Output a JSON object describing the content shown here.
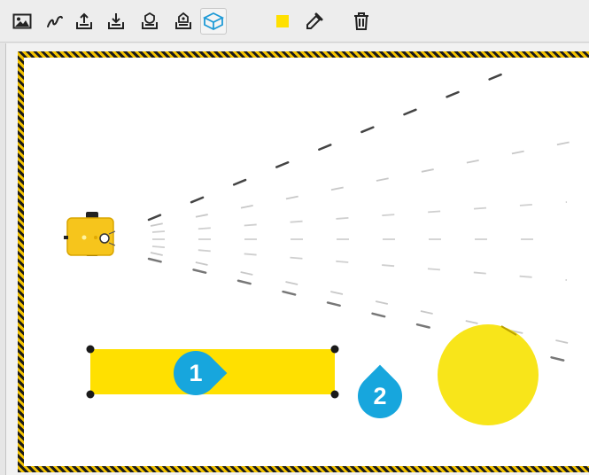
{
  "toolbar": {
    "tools": [
      {
        "name": "background-image",
        "icon": "image-icon"
      },
      {
        "name": "draw-path",
        "icon": "freehand-path-icon"
      },
      {
        "name": "export",
        "icon": "upload-tray-icon"
      },
      {
        "name": "import",
        "icon": "download-tray-icon"
      },
      {
        "name": "import-alt",
        "icon": "shield-tray-icon"
      },
      {
        "name": "3d-view",
        "icon": "cube-icon",
        "active": true
      },
      {
        "name": "fill-color",
        "icon": "color-swatch-icon",
        "color": "#ffe000"
      },
      {
        "name": "eyedropper",
        "icon": "eyedropper-icon"
      },
      {
        "name": "delete",
        "icon": "trash-icon"
      }
    ]
  },
  "colors": {
    "accent": "#17a6dd",
    "object_fill": "#ffe000",
    "circle_fill": "#f8e51a",
    "robot_body": "#f6c51c",
    "hazard_dark": "#1b1b1b",
    "hazard_light": "#f2c200"
  },
  "callouts": {
    "first": "1",
    "second": "2"
  }
}
